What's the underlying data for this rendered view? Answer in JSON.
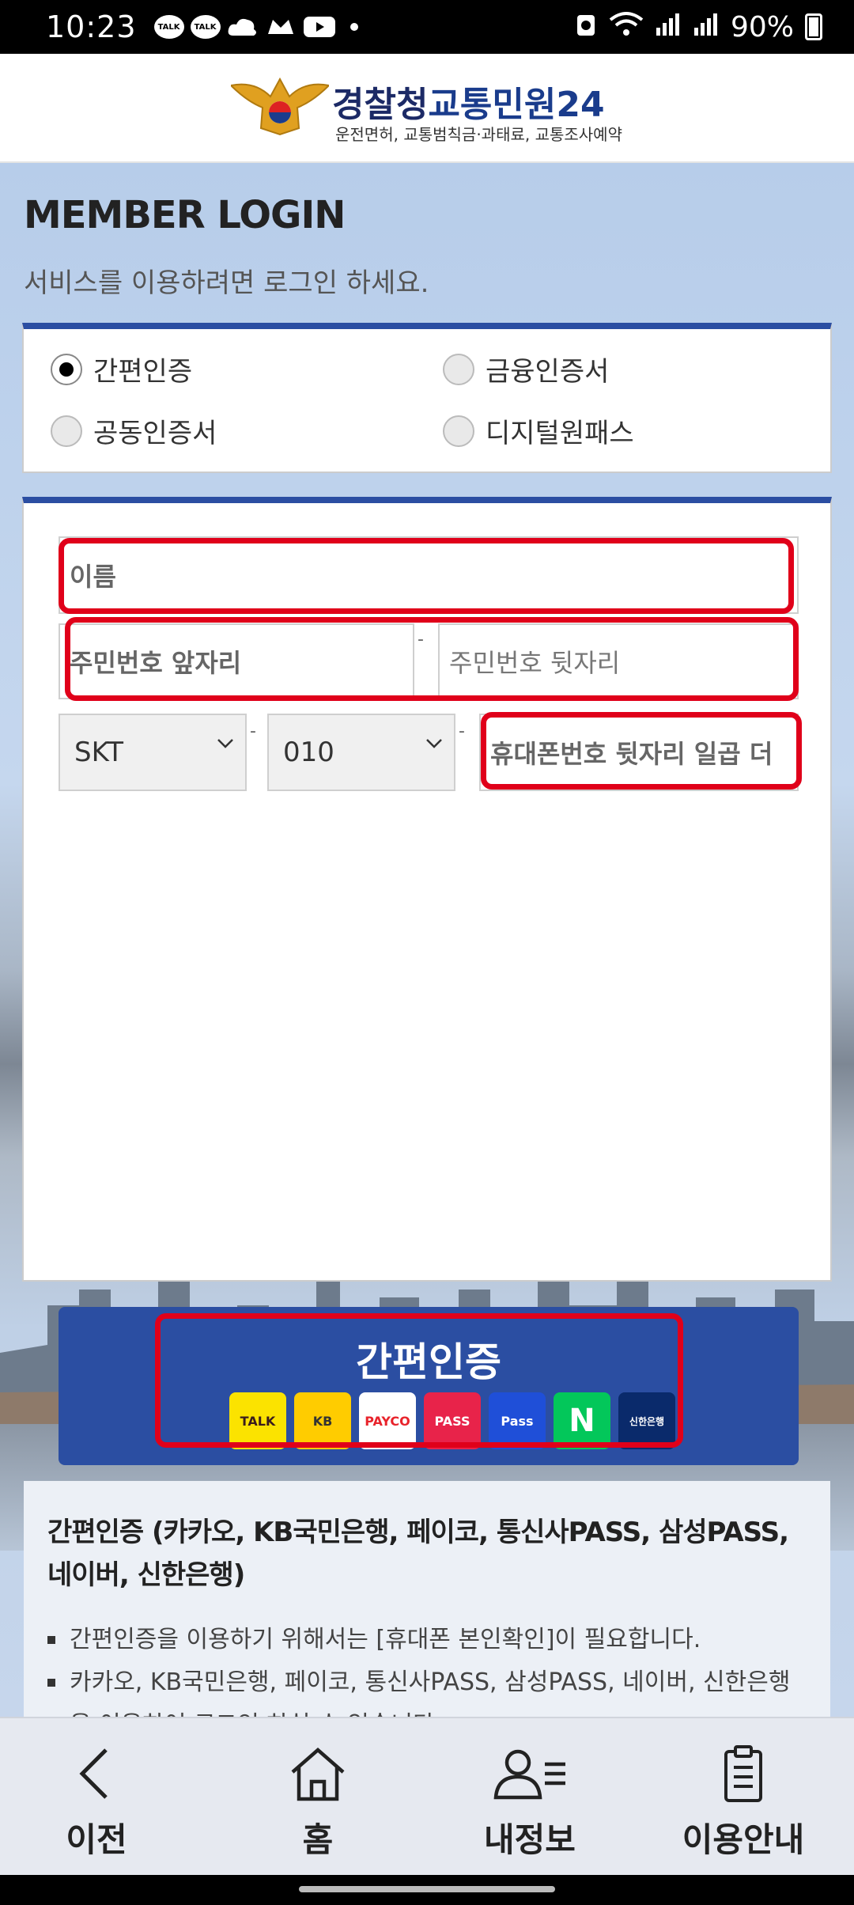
{
  "status_bar": {
    "time": "10:23",
    "battery": "90%",
    "talk1": "TALK",
    "talk2": "TALK"
  },
  "header": {
    "title_part1": "경찰청",
    "title_part2": "교통민원24",
    "subtitle": "운전면허, 교통범칙금·과태료, 교통조사예약"
  },
  "login": {
    "title": "MEMBER LOGIN",
    "subtitle": "서비스를 이용하려면 로그인 하세요."
  },
  "methods": [
    {
      "label": "간편인증",
      "selected": true
    },
    {
      "label": "금융인증서",
      "selected": false
    },
    {
      "label": "공동인증서",
      "selected": false
    },
    {
      "label": "디지털원패스",
      "selected": false
    }
  ],
  "form": {
    "name_placeholder": "이름",
    "rrn_front_placeholder": "주민번호 앞자리",
    "rrn_back_placeholder": "주민번호 뒷자리",
    "carrier": "SKT",
    "prefix": "010",
    "phone_placeholder": "휴대폰번호 뒷자리 일곱 더",
    "dash": "-"
  },
  "auth_button": {
    "label": "간편인증",
    "providers": [
      {
        "name": "TALK",
        "bg": "#fbe300",
        "fg": "#3a1d1d"
      },
      {
        "name": "KB",
        "bg": "#ffcc00",
        "fg": "#333333"
      },
      {
        "name": "PAYCO",
        "bg": "#ffffff",
        "fg": "#e8232b"
      },
      {
        "name": "PASS",
        "bg": "#e8234a",
        "fg": "#ffffff"
      },
      {
        "name": "Pass",
        "bg": "#1f4fd8",
        "fg": "#ffffff"
      },
      {
        "name": "N",
        "bg": "#03c75a",
        "fg": "#ffffff"
      },
      {
        "name": "신한은행",
        "bg": "#0a2a6b",
        "fg": "#ffffff"
      }
    ]
  },
  "info": {
    "heading": "간편인증 (카카오, KB국민은행, 페이코, 통신사PASS, 삼성PASS, 네이버, 신한은행)",
    "bullets": [
      "간편인증을 이용하기 위해서는 [휴대폰 본인확인]이 필요합니다.",
      "카카오, KB국민은행, 페이코, 통신사PASS, 삼성PASS, 네이버, 신한은행을 이용하여 로그인 하실 수 있습니다."
    ]
  },
  "nav": {
    "back": "이전",
    "home": "홈",
    "myinfo": "내정보",
    "guide": "이용안내"
  },
  "colors": {
    "brand_blue": "#2b4ea2",
    "highlight_red": "#e0001a"
  }
}
